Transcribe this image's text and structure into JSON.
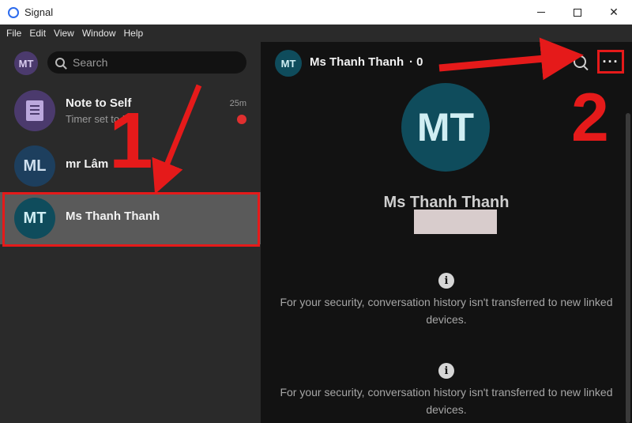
{
  "window": {
    "title": "Signal"
  },
  "menu": [
    "File",
    "Edit",
    "View",
    "Window",
    "Help"
  ],
  "sidebar": {
    "me_initials": "MT",
    "search_placeholder": "Search",
    "conversations": [
      {
        "name": "Note to Self",
        "preview": "Timer set to 5s",
        "time": "25m"
      },
      {
        "initials": "ML",
        "name": "mr Lâm"
      },
      {
        "initials": "MT",
        "name": "Ms Thanh Thanh"
      }
    ]
  },
  "header": {
    "initials": "MT",
    "name": "Ms Thanh Thanh",
    "meta": "· 0",
    "more_label": "···"
  },
  "profile": {
    "initials": "MT",
    "name": "Ms Thanh Thanh"
  },
  "notices": [
    "For your security, conversation history isn't transferred to new linked devices.",
    "For your security, conversation history isn't transferred to new linked devices."
  ],
  "annotations": {
    "step1": "1",
    "step2": "2"
  },
  "colors": {
    "highlight": "#e51a1a",
    "accent": "#2c6bed"
  }
}
